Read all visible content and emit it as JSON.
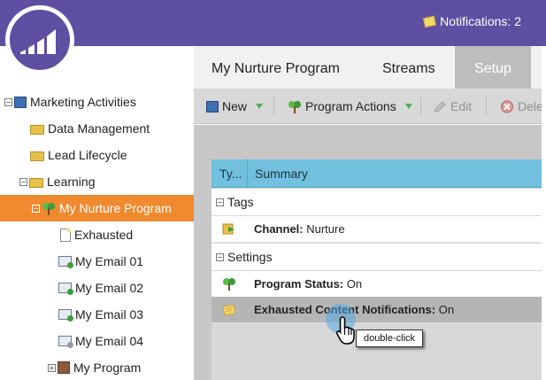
{
  "header": {
    "brand_color": "#5e4fa2",
    "notifications_label": "Notifications: 2",
    "logo_icon": "marketo-logo-icon"
  },
  "tabs": [
    {
      "label": "My Nurture Program",
      "active": false
    },
    {
      "label": "Streams",
      "active": false
    },
    {
      "label": "Setup",
      "active": true
    }
  ],
  "tree": {
    "selected_color": "#f08a2e",
    "items": [
      {
        "label": "Marketing Activities",
        "icon": "marketing-activities-icon",
        "expander": "−"
      },
      {
        "label": "Data Management",
        "icon": "folder-icon",
        "expander": ""
      },
      {
        "label": "Lead Lifecycle",
        "icon": "folder-icon",
        "expander": ""
      },
      {
        "label": "Learning",
        "icon": "folder-icon",
        "expander": "−"
      },
      {
        "label": "My Nurture Program",
        "icon": "nurture-program-icon",
        "expander": "−",
        "selected": true
      },
      {
        "label": "Exhausted",
        "icon": "document-icon",
        "expander": ""
      },
      {
        "label": "My Email 01",
        "icon": "email-icon",
        "expander": ""
      },
      {
        "label": "My Email 02",
        "icon": "email-icon",
        "expander": ""
      },
      {
        "label": "My Email 03",
        "icon": "email-icon",
        "expander": ""
      },
      {
        "label": "My Email 04",
        "icon": "email-icon",
        "expander": ""
      },
      {
        "label": "My Program",
        "icon": "program-icon",
        "expander": "+"
      }
    ]
  },
  "toolbar": {
    "new_label": "New",
    "program_actions_label": "Program Actions",
    "edit_label": "Edit",
    "delete_label": "Delete"
  },
  "grid": {
    "header_color": "#71c0de",
    "col_type": "Ty...",
    "col_summary": "Summary",
    "groups": [
      {
        "label": "Tags",
        "expander": "−",
        "rows": [
          {
            "icon": "channel-tag-icon",
            "key": "Channel:",
            "value": " Nurture"
          }
        ]
      },
      {
        "label": "Settings",
        "expander": "−",
        "rows": [
          {
            "icon": "program-status-icon",
            "key": "Program Status:",
            "value": " On"
          },
          {
            "icon": "notification-icon",
            "key": "Exhausted Content Notifications:",
            "value": " On",
            "highlighted": true
          }
        ]
      }
    ]
  },
  "tooltip": {
    "label": "double-click"
  }
}
